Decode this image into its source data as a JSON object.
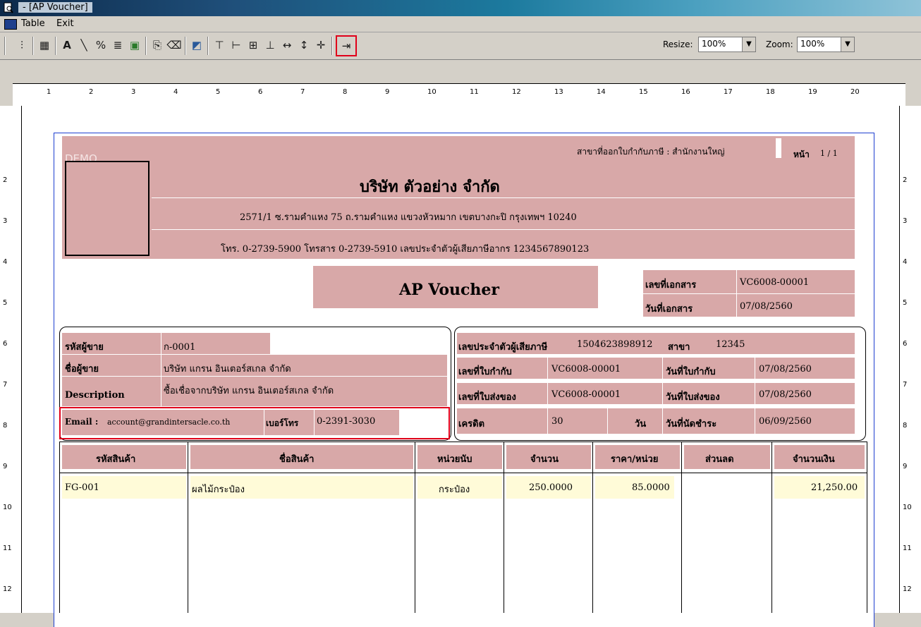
{
  "window": {
    "title": " - [AP Voucher]"
  },
  "menu": {
    "items": [
      "Table",
      "Exit"
    ]
  },
  "toolbar": {
    "resize_label": "Resize:",
    "resize_value": "100%",
    "zoom_label": "Zoom:",
    "zoom_value": "100%",
    "icons": [
      "field-list-icon",
      "table-icon",
      "text-icon",
      "line-icon",
      "percent-icon",
      "formula-icon",
      "image-icon",
      "page-setup-icon",
      "eraser-icon",
      "color-icon",
      "align-top-icon",
      "align-left-icon",
      "align-grid-icon",
      "align-bottom-icon",
      "same-width-icon",
      "same-height-icon",
      "center-icon",
      "exit-report-icon"
    ]
  },
  "ruler": {
    "marks": [
      "1",
      "2",
      "3",
      "4",
      "5",
      "6",
      "7",
      "8",
      "9",
      "10",
      "11",
      "12",
      "13",
      "14",
      "15",
      "16",
      "17",
      "18",
      "19",
      "20"
    ],
    "vmarks": [
      "2",
      "3",
      "4",
      "5",
      "6",
      "7",
      "8",
      "9",
      "10",
      "11",
      "12"
    ]
  },
  "report": {
    "demo": "DEMO",
    "branch": "สาขาที่ออกใบกำกับภาษี : สำนักงานใหญ่",
    "page_label": "หน้า",
    "page_value": "1 / 1",
    "company": "บริษัท ตัวอย่าง จำกัด",
    "address": "2571/1 ซ.รามคำแหง 75 ถ.รามคำแหง แขวงหัวหมาก เขตบางกะปิ กรุงเทพฯ 10240",
    "contact": "โทร. 0-2739-5900  โทรสาร 0-2739-5910  เลขประจำตัวผู้เสียภาษีอากร 1234567890123",
    "doc_title": "AP Voucher",
    "doc_no_label": "เลขที่เอกสาร",
    "doc_no": "VC6008-00001",
    "doc_date_label": "วันที่เอกสาร",
    "doc_date": "07/08/2560",
    "vendor_code_label": "รหัสผู้ขาย",
    "vendor_code": "ก-0001",
    "vendor_name_label": "ชื่อผู้ขาย",
    "vendor_name": "บริษัท แกรน อินเตอร์สเกล จำกัด",
    "desc_label": "Description",
    "desc": "ซื้อเชื่อจากบริษัท แกรน อินเตอร์สเกล จำกัด",
    "email_label": "Email :",
    "email": "account@grandintersacle.co.th",
    "phone_label": "เบอร์โทร",
    "phone": "0-2391-3030",
    "tax_id_label": "เลขประจำตัวผู้เสียภาษี",
    "tax_id": "1504623898912",
    "branch_label": "สาขา",
    "branch_no": "12345",
    "inv_no_label": "เลขที่ใบกำกับ",
    "inv_no": "VC6008-00001",
    "inv_date_label": "วันที่ใบกำกับ",
    "inv_date": "07/08/2560",
    "dn_no_label": "เลขที่ใบส่งของ",
    "dn_no": "VC6008-00001",
    "dn_date_label": "วันที่ใบส่งของ",
    "dn_date": "07/08/2560",
    "credit_label": "เครดิต",
    "credit": "30",
    "credit_unit": "วัน",
    "due_label": "วันที่นัดชำระ",
    "due": "06/09/2560",
    "columns": [
      "รหัสสินค้า",
      "ชื่อสินค้า",
      "หน่วยนับ",
      "จำนวน",
      "ราคา/หน่วย",
      "ส่วนลด",
      "จำนวนเงิน"
    ],
    "rows": [
      {
        "code": "FG-001",
        "name": "ผลไม้กระป๋อง",
        "unit": "กระป๋อง",
        "qty": "250.0000",
        "price": "85.0000",
        "discount": "",
        "amount": "21,250.00"
      }
    ]
  }
}
